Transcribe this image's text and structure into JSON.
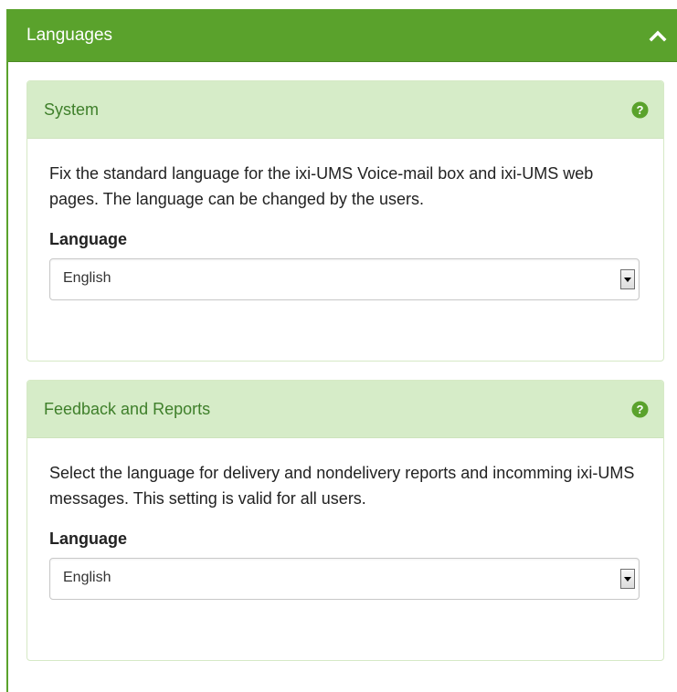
{
  "header": {
    "title": "Languages",
    "toggle_icon": "chevron-up-icon"
  },
  "colors": {
    "accent": "#5aa22c",
    "panel_heading_bg": "#d6ecc8",
    "panel_title": "#3e7f2a"
  },
  "panels": [
    {
      "title": "System",
      "help_icon": "question-circle-icon",
      "description": "Fix the standard language for the ixi-UMS Voice-mail box and ixi-UMS web pages. The language can be changed by the users.",
      "field_label": "Language",
      "selected": "English"
    },
    {
      "title": "Feedback and Reports",
      "help_icon": "question-circle-icon",
      "description": "Select the language for delivery and nondelivery reports and incomming ixi-UMS messages. This setting is valid for all users.",
      "field_label": "Language",
      "selected": "English"
    }
  ]
}
